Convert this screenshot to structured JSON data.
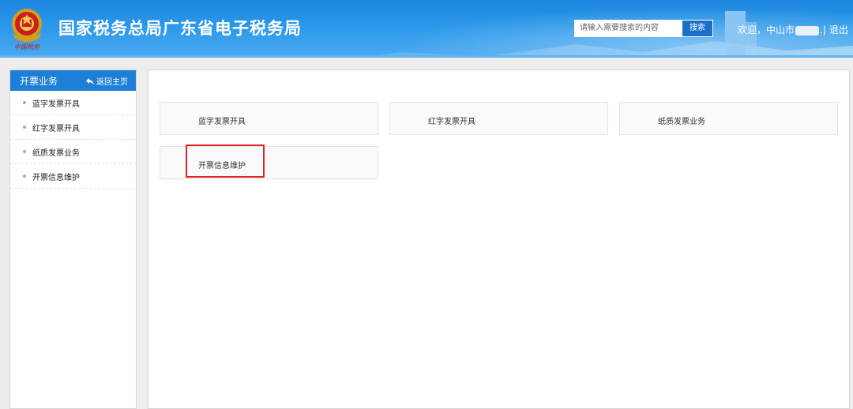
{
  "header": {
    "title": "国家税务总局广东省电子税务局",
    "emblem_text": "中国税务",
    "search_placeholder": "请输入需要搜索的内容",
    "search_button": "搜索",
    "welcome": "欢迎，中山市",
    "welcome_suffix": "..",
    "separator": "|",
    "logout": "退出"
  },
  "sidebar": {
    "title": "开票业务",
    "back_label": "返回主页",
    "back_icon": "arrow-back-icon",
    "items": [
      {
        "label": "蓝字发票开具"
      },
      {
        "label": "红字发票开具"
      },
      {
        "label": "纸质发票业务"
      },
      {
        "label": "开票信息维护"
      }
    ]
  },
  "main": {
    "cards": [
      {
        "label": "蓝字发票开具"
      },
      {
        "label": "红字发票开具"
      },
      {
        "label": "纸质发票业务"
      },
      {
        "label": "开票信息维护"
      }
    ]
  },
  "colors": {
    "header": "#2b98ea",
    "accent": "#1e7fd6",
    "highlight": "#e02424"
  }
}
